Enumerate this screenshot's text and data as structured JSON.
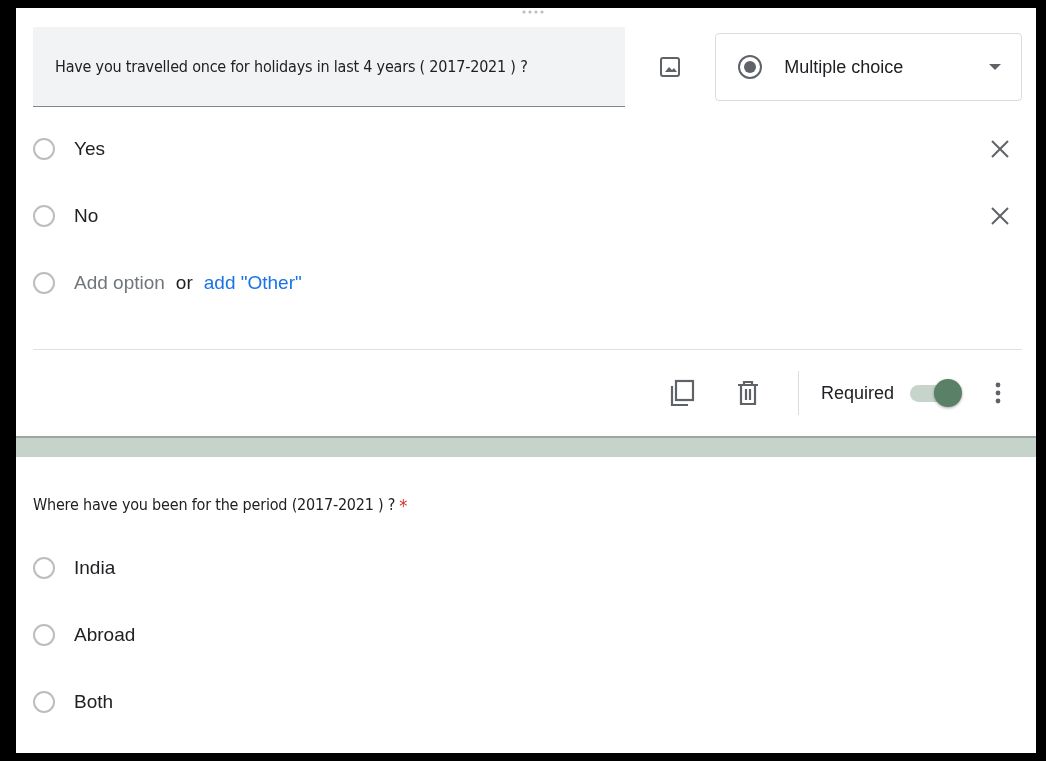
{
  "editor": {
    "question": "Have you travelled once for holidays in last 4 years ( 2017-2021 ) ?",
    "type_select": {
      "label": "Multiple choice"
    },
    "options": [
      {
        "label": "Yes",
        "selected": false
      },
      {
        "label": "No",
        "selected": false
      }
    ],
    "add_option": {
      "selected": false,
      "placeholder": "Add option",
      "or": "or",
      "other_link": "add \"Other\""
    },
    "required": {
      "label": "Required",
      "on": true
    }
  },
  "preview": {
    "question": "Where have you been for the period (2017-2021 ) ?",
    "required_mark": "*",
    "options": [
      {
        "label": "India",
        "selected": false
      },
      {
        "label": "Abroad",
        "selected": false
      },
      {
        "label": "Both",
        "selected": false
      }
    ]
  }
}
